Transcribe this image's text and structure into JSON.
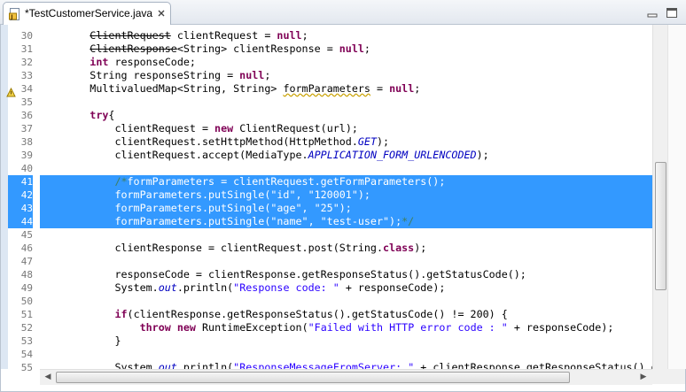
{
  "tab": {
    "title": "*TestCustomerService.java",
    "icon": "java-file-icon",
    "close_icon": "close-icon"
  },
  "window_controls": [
    "minimize-icon",
    "maximize-icon"
  ],
  "editor": {
    "lines": [
      {
        "n": "30",
        "tokens": [
          {
            "t": "        "
          },
          {
            "t": "ClientRequest",
            "c": "strk"
          },
          {
            "t": " clientRequest = "
          },
          {
            "t": "null",
            "c": "kw"
          },
          {
            "t": ";"
          }
        ]
      },
      {
        "n": "31",
        "tokens": [
          {
            "t": "        "
          },
          {
            "t": "ClientResponse",
            "c": "strk"
          },
          {
            "t": "<String> clientResponse = "
          },
          {
            "t": "null",
            "c": "kw"
          },
          {
            "t": ";"
          }
        ]
      },
      {
        "n": "32",
        "tokens": [
          {
            "t": "        "
          },
          {
            "t": "int",
            "c": "kw"
          },
          {
            "t": " responseCode;"
          }
        ]
      },
      {
        "n": "33",
        "tokens": [
          {
            "t": "        String responseString = "
          },
          {
            "t": "null",
            "c": "kw"
          },
          {
            "t": ";"
          }
        ]
      },
      {
        "n": "34",
        "tokens": [
          {
            "t": "        MultivaluedMap<String, String> "
          },
          {
            "t": "formParameters",
            "c": "warn"
          },
          {
            "t": " = "
          },
          {
            "t": "null",
            "c": "kw"
          },
          {
            "t": ";"
          }
        ]
      },
      {
        "n": "35",
        "tokens": []
      },
      {
        "n": "36",
        "tokens": [
          {
            "t": "        "
          },
          {
            "t": "try",
            "c": "kw"
          },
          {
            "t": "{"
          }
        ]
      },
      {
        "n": "37",
        "tokens": [
          {
            "t": "            clientRequest = "
          },
          {
            "t": "new",
            "c": "kw"
          },
          {
            "t": " ClientRequest(url);"
          }
        ]
      },
      {
        "n": "38",
        "tokens": [
          {
            "t": "            clientRequest.setHttpMethod(HttpMethod."
          },
          {
            "t": "GET",
            "c": "cst"
          },
          {
            "t": ");"
          }
        ]
      },
      {
        "n": "39",
        "tokens": [
          {
            "t": "            clientRequest.accept(MediaType."
          },
          {
            "t": "APPLICATION_FORM_URLENCODED",
            "c": "cst"
          },
          {
            "t": ");"
          }
        ]
      },
      {
        "n": "40",
        "tokens": []
      },
      {
        "n": "41",
        "sel": true,
        "tokens": [
          {
            "t": "            /*",
            "c": "cmt"
          },
          {
            "t": "formParameters = clientRequest.getFormParameters();",
            "c": "csel"
          }
        ]
      },
      {
        "n": "42",
        "sel": true,
        "tokens": [
          {
            "t": "            formParameters.putSingle(\"id\", \"120001\");",
            "c": "csel"
          }
        ]
      },
      {
        "n": "43",
        "sel": true,
        "tokens": [
          {
            "t": "            formParameters.putSingle(\"age\", \"25\");",
            "c": "csel"
          }
        ]
      },
      {
        "n": "44",
        "sel": true,
        "tokens": [
          {
            "t": "            formParameters.putSingle(\"name\", \"test-user\");",
            "c": "csel"
          },
          {
            "t": "*/",
            "c": "cmt"
          }
        ]
      },
      {
        "n": "45",
        "tokens": []
      },
      {
        "n": "46",
        "tokens": [
          {
            "t": "            clientResponse = clientRequest.post(String."
          },
          {
            "t": "class",
            "c": "kw"
          },
          {
            "t": ");"
          }
        ]
      },
      {
        "n": "47",
        "tokens": []
      },
      {
        "n": "48",
        "tokens": [
          {
            "t": "            responseCode = clientResponse.getResponseStatus().getStatusCode();"
          }
        ]
      },
      {
        "n": "49",
        "tokens": [
          {
            "t": "            System."
          },
          {
            "t": "out",
            "c": "fi"
          },
          {
            "t": ".println("
          },
          {
            "t": "\"Response code: \"",
            "c": "str"
          },
          {
            "t": " + responseCode);"
          }
        ]
      },
      {
        "n": "50",
        "tokens": []
      },
      {
        "n": "51",
        "tokens": [
          {
            "t": "            "
          },
          {
            "t": "if",
            "c": "kw"
          },
          {
            "t": "(clientResponse.getResponseStatus().getStatusCode() != 200) {"
          }
        ]
      },
      {
        "n": "52",
        "tokens": [
          {
            "t": "                "
          },
          {
            "t": "throw",
            "c": "kw"
          },
          {
            "t": " "
          },
          {
            "t": "new",
            "c": "kw"
          },
          {
            "t": " RuntimeException("
          },
          {
            "t": "\"Failed with HTTP error code : \"",
            "c": "str"
          },
          {
            "t": " + responseCode);"
          }
        ]
      },
      {
        "n": "53",
        "tokens": [
          {
            "t": "            }"
          }
        ]
      },
      {
        "n": "54",
        "tokens": []
      },
      {
        "n": "55",
        "tokens": [
          {
            "t": "            System."
          },
          {
            "t": "out",
            "c": "fi"
          },
          {
            "t": ".println("
          },
          {
            "t": "\"ResponseMessageFromServer: \"",
            "c": "str"
          },
          {
            "t": " + clientResponse.getResponseStatus().g"
          }
        ]
      }
    ]
  },
  "colors": {
    "keyword": "#7f0055",
    "string": "#2a00ff",
    "constant": "#0000c0",
    "comment": "#3f7f5f",
    "selection": "#3399ff",
    "line_number": "#787878"
  }
}
